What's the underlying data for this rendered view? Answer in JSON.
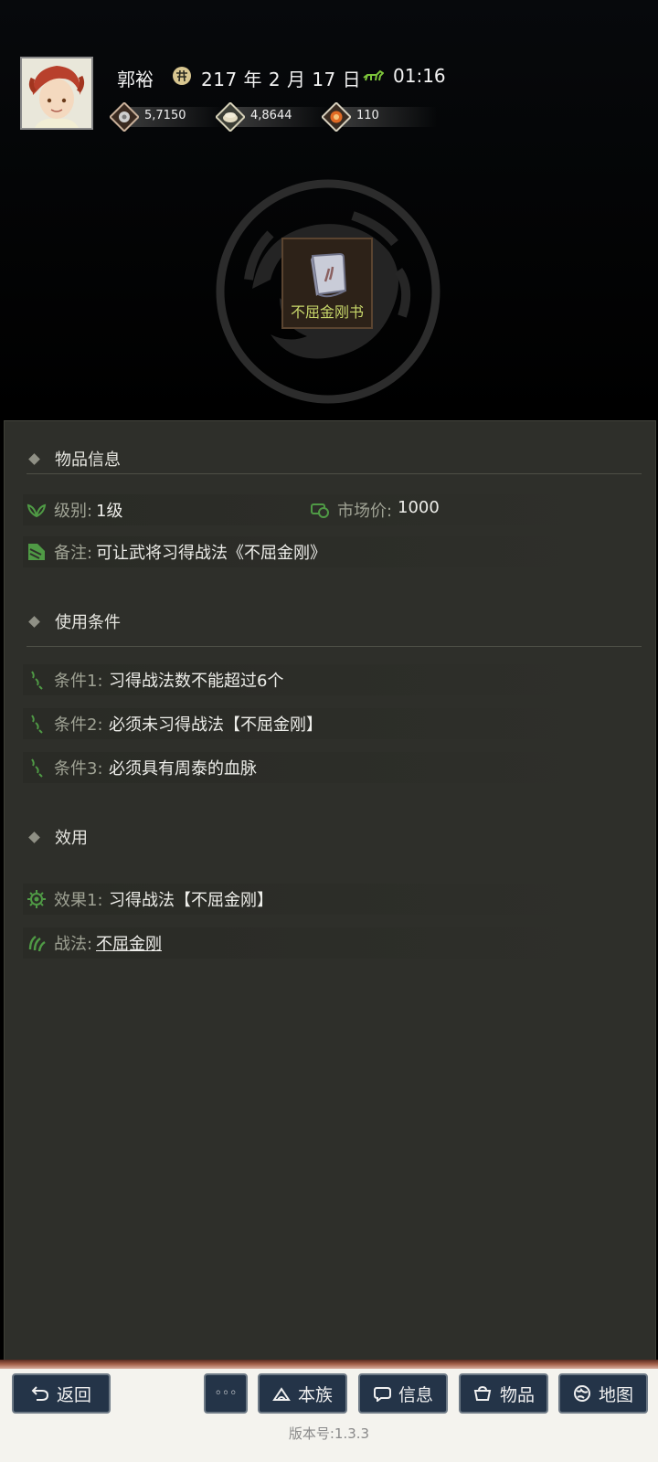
{
  "header": {
    "player_name": "郭裕",
    "date": "217 年 2 月 17 日",
    "time": "01:16",
    "resources": [
      {
        "icon": "silver-coin-icon",
        "value": "5,7150"
      },
      {
        "icon": "grain-icon",
        "value": "4,8644"
      },
      {
        "icon": "gold-coin-icon",
        "value": "110"
      }
    ]
  },
  "item": {
    "name": "不屈金刚书"
  },
  "sections": {
    "info": {
      "title": "物品信息",
      "level_label": "级别:",
      "level_value": "1级",
      "price_label": "市场价:",
      "price_value": "1000",
      "note_label": "备注:",
      "note_value": "可让武将习得战法《不屈金刚》"
    },
    "conditions": {
      "title": "使用条件",
      "items": [
        {
          "label": "条件1:",
          "text": "习得战法数不能超过6个"
        },
        {
          "label": "条件2:",
          "text": "必须未习得战法【不屈金刚】"
        },
        {
          "label": "条件3:",
          "text": "必须具有周泰的血脉"
        }
      ]
    },
    "effects": {
      "title": "效用",
      "effect_label": "效果1:",
      "effect_text": "习得战法【不屈金刚】",
      "tactic_label": "战法:",
      "tactic_link": "不屈金刚"
    }
  },
  "bottom": {
    "back_label": "返回",
    "more_label": "◦◦◦",
    "clan_label": "本族",
    "info_label": "信息",
    "items_label": "物品",
    "map_label": "地图",
    "version": "版本号:1.3.3"
  },
  "colors": {
    "accent_green": "#7fbf3a",
    "panel_bg": "#2e2f2a",
    "button_bg": "#243448"
  }
}
